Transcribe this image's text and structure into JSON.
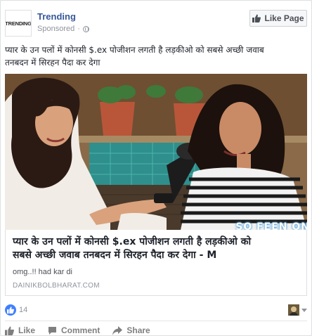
{
  "post": {
    "page_logo_text": "TRENDING",
    "page_name": "Trending",
    "sponsored_label": "Sponsored",
    "meta_separator": "·",
    "like_page_label": "Like Page",
    "text_line1": "प्यार के उन पलों में कोनसी $.ex पोजीशन लगती है लड़कीओ को सबसे अच्छी जवाब",
    "text_line2": "तनबदन में सिरहन पैदा कर देगा"
  },
  "image": {
    "watermark_text": "SO FEEN ON"
  },
  "link": {
    "title_line1": "प्यार के उन पलों में कोनसी $.ex पोजीशन लगती है लड़कीओ को",
    "title_line2": "सबसे अच्छी जवाब तनबदन में सिरहन पैदा कर देगा - M",
    "description": "omg..!! had kar di",
    "domain": "DAINIKBOLBHARAT.COM"
  },
  "reactions": {
    "count": "14"
  },
  "actions": {
    "like": "Like",
    "comment": "Comment",
    "share": "Share"
  },
  "colors": {
    "link_blue": "#365899",
    "like_badge": "#4080ff",
    "muted": "#90949c"
  }
}
